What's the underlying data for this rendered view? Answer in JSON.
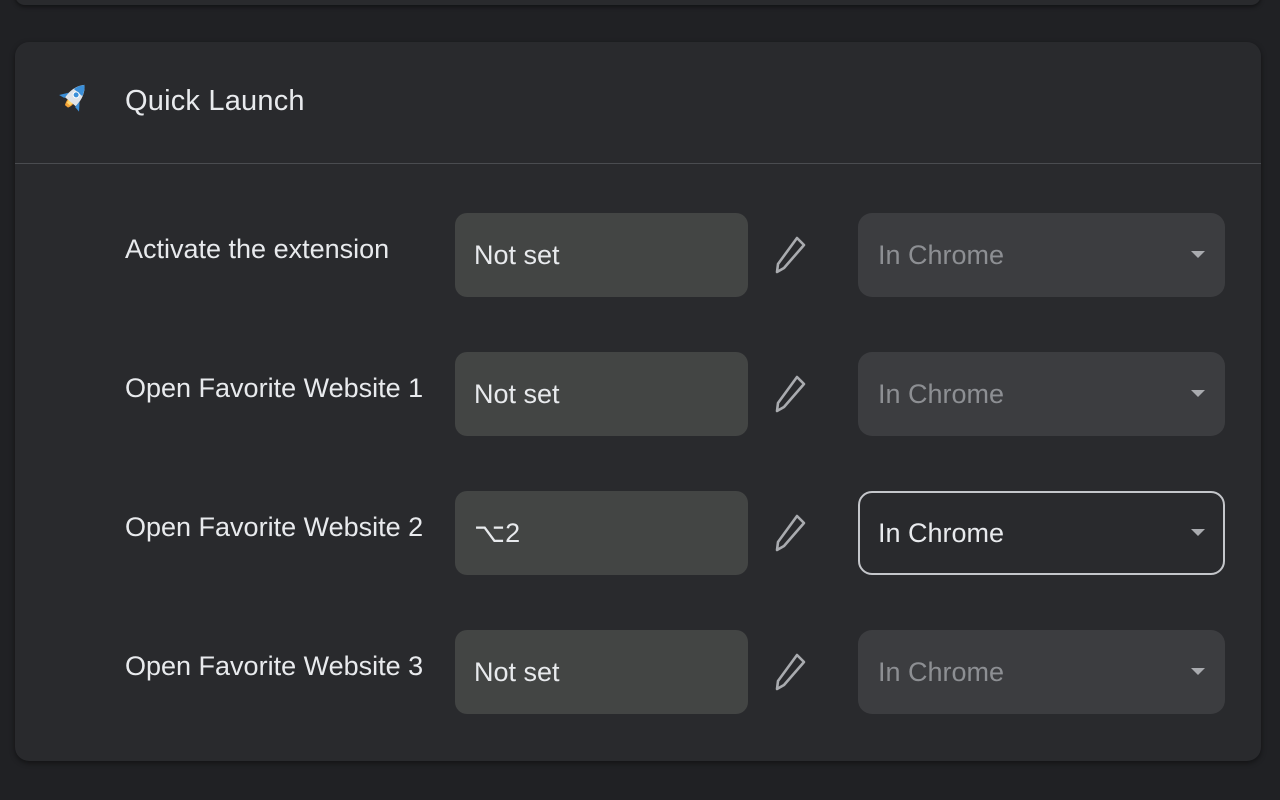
{
  "card": {
    "title": "Quick Launch",
    "icon": "rocket-icon"
  },
  "rows": [
    {
      "label": "Activate the extension",
      "shortcut": "Not set",
      "scope": "In Chrome",
      "scope_enabled": false
    },
    {
      "label": "Open Favorite Website 1",
      "shortcut": "Not set",
      "scope": "In Chrome",
      "scope_enabled": false
    },
    {
      "label": "Open Favorite Website 2",
      "shortcut": "⌥2",
      "scope": "In Chrome",
      "scope_enabled": true
    },
    {
      "label": "Open Favorite Website 3",
      "shortcut": "Not set",
      "scope": "In Chrome",
      "scope_enabled": false
    }
  ],
  "colors": {
    "page_background": "#202124",
    "card_background": "#292a2d",
    "field_background": "#434544",
    "select_disabled_background": "#3c3d40",
    "text_primary": "#e8eaed",
    "text_disabled": "#8d8f93"
  }
}
